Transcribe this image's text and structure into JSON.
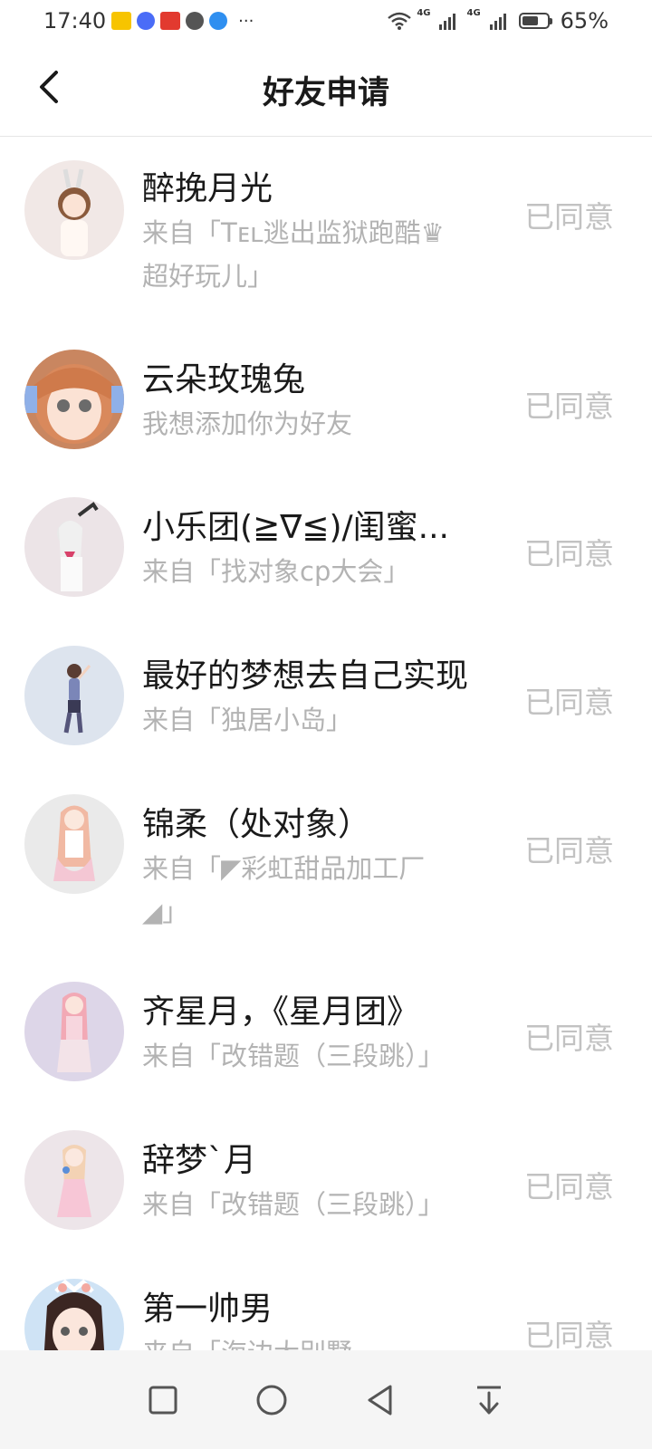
{
  "status_bar": {
    "time": "17:40",
    "more": "···",
    "network_1": "4G",
    "network_2": "4G",
    "battery": "65%",
    "battery_level": 0.65
  },
  "header": {
    "title": "好友申请",
    "back_icon": "back-arrow-icon"
  },
  "requests": [
    {
      "name": "醉挽月光",
      "source_line1": "来自「Tᴇʟ逃出监狱跑酷♛",
      "source_line2": "超好玩儿」",
      "status": "已同意"
    },
    {
      "name": "云朵玫瑰兔",
      "source_line1": "我想添加你为好友",
      "source_line2": "",
      "status": "已同意"
    },
    {
      "name": "小乐团(≧∇≦)/闺蜜...",
      "source_line1": "来自「找对象cp大会」",
      "source_line2": "",
      "status": "已同意"
    },
    {
      "name": "最好的梦想去自己实现",
      "source_line1": "来自「独居小岛」",
      "source_line2": "",
      "status": "已同意"
    },
    {
      "name": "锦柔（处对象）",
      "source_line1": "来自「◤彩虹甜品加工厂",
      "source_line2": "◢」",
      "status": "已同意"
    },
    {
      "name": "齐星月，《星月团》",
      "source_line1": "来自「改错题（三段跳）」",
      "source_line2": "",
      "status": "已同意"
    },
    {
      "name": "辞梦`月",
      "source_line1": "来自「改错题（三段跳）」",
      "source_line2": "",
      "status": "已同意"
    },
    {
      "name": "第一帅男",
      "source_line1": "来自「海边大别墅",
      "source_line2": "",
      "status": "已同意"
    }
  ],
  "nav": {
    "square": "recent-apps-icon",
    "circle": "home-icon",
    "triangle": "back-icon",
    "down": "notification-pull-icon"
  },
  "colors": {
    "name": "#1a1a1a",
    "source": "#b3b3b3",
    "status": "#c2c2c2",
    "divider": "#e6e6e6"
  }
}
